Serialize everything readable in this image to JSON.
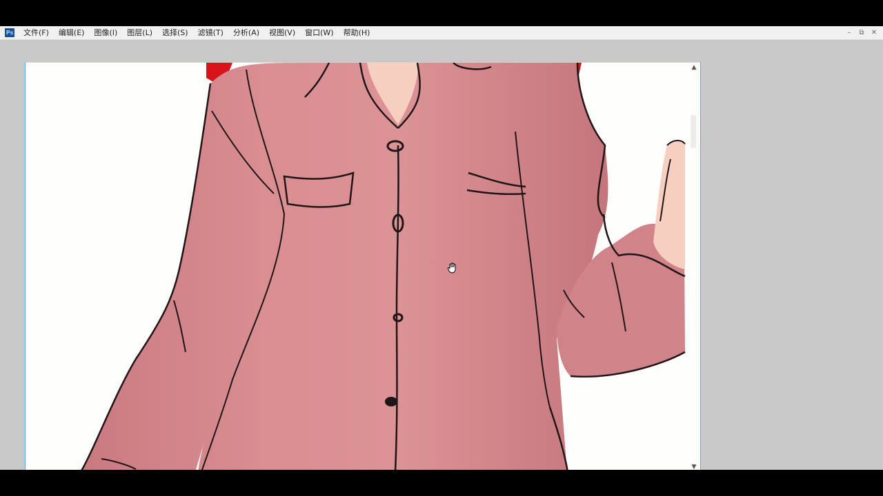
{
  "app": {
    "logo_text": "Ps",
    "menu": [
      {
        "label": "文件(F)"
      },
      {
        "label": "编辑(E)"
      },
      {
        "label": "图像(I)"
      },
      {
        "label": "图层(L)"
      },
      {
        "label": "选择(S)"
      },
      {
        "label": "滤镜(T)"
      },
      {
        "label": "分析(A)"
      },
      {
        "label": "视图(V)"
      },
      {
        "label": "窗口(W)"
      },
      {
        "label": "帮助(H)"
      }
    ],
    "window_controls": {
      "minimize": "–",
      "restore": "⧉",
      "close": "✕"
    }
  },
  "document": {
    "scroll_up_arrow": "▲",
    "scroll_down_arrow": "▼"
  },
  "colors": {
    "shirt": "#d4868a",
    "shirt_shadow": "#b86a70",
    "collar_red": "#d7141c",
    "skin": "#f6cfc0",
    "line": "#1f1416",
    "workspace": "#c8c8c8",
    "canvas_bg": "#fefefd"
  },
  "icons": {
    "cursor": "hand-grab-icon"
  }
}
